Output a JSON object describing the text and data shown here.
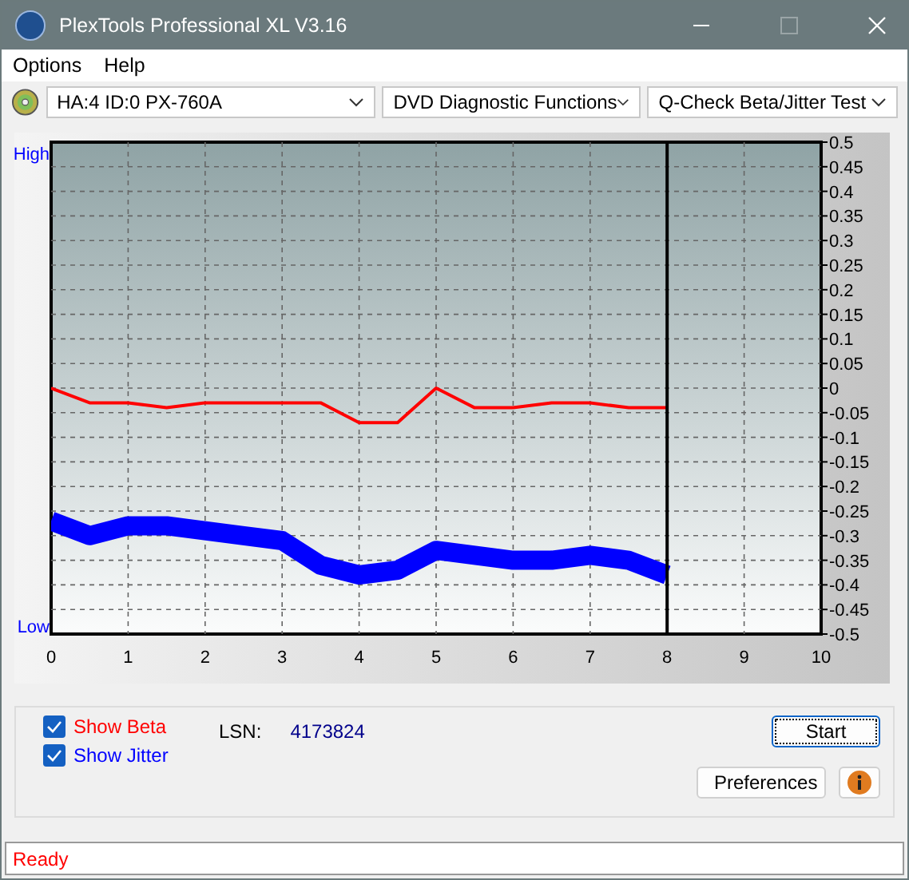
{
  "window": {
    "title": "PlexTools Professional XL V3.16"
  },
  "menu": [
    {
      "label": "Options"
    },
    {
      "label": "Help"
    }
  ],
  "toolbar": {
    "drive": "HA:4 ID:0  PX-760A",
    "function": "DVD Diagnostic Functions",
    "test": "Q-Check Beta/Jitter Test"
  },
  "chart": {
    "high_label": "High",
    "low_label": "Low",
    "chart_data": {
      "type": "line",
      "x": [
        0,
        0.5,
        1,
        1.5,
        2,
        2.5,
        3,
        3.5,
        4,
        4.5,
        5,
        5.5,
        6,
        6.5,
        7,
        7.5,
        8
      ],
      "series": [
        {
          "color": "#ff0000",
          "values": [
            0.0,
            -0.03,
            -0.03,
            -0.04,
            -0.03,
            -0.03,
            -0.03,
            -0.03,
            -0.07,
            -0.07,
            0.0,
            -0.04,
            -0.04,
            -0.03,
            -0.03,
            -0.04,
            -0.04
          ]
        },
        {
          "color": "#0000ff",
          "values": [
            -0.27,
            -0.3,
            -0.28,
            -0.28,
            -0.29,
            -0.3,
            -0.31,
            -0.36,
            -0.38,
            -0.37,
            -0.33,
            -0.34,
            -0.35,
            -0.35,
            -0.34,
            -0.35,
            -0.38
          ]
        }
      ],
      "xlim": [
        0,
        10
      ],
      "ylim": [
        -0.5,
        0.5
      ],
      "xticks": [
        0,
        1,
        2,
        3,
        4,
        5,
        6,
        7,
        8,
        9,
        10
      ],
      "yticks": [
        0.5,
        0.45,
        0.4,
        0.35,
        0.3,
        0.25,
        0.2,
        0.15,
        0.1,
        0.05,
        0,
        -0.05,
        -0.1,
        -0.15,
        -0.2,
        -0.25,
        -0.3,
        -0.35,
        -0.4,
        -0.45,
        -0.5
      ],
      "grid": true,
      "ref_lines": [
        {
          "axis": "x",
          "value": 8,
          "color": "#000000"
        }
      ]
    }
  },
  "options": [
    {
      "label": "Show Beta",
      "checked": true,
      "color": "#ff0000"
    },
    {
      "label": "Show Jitter",
      "checked": true,
      "color": "#0000ff"
    }
  ],
  "lsn": {
    "label": "LSN:",
    "value": "4173824"
  },
  "buttons": {
    "start": "Start",
    "preferences": "Preferences"
  },
  "status_bar": {
    "text": "Ready"
  }
}
